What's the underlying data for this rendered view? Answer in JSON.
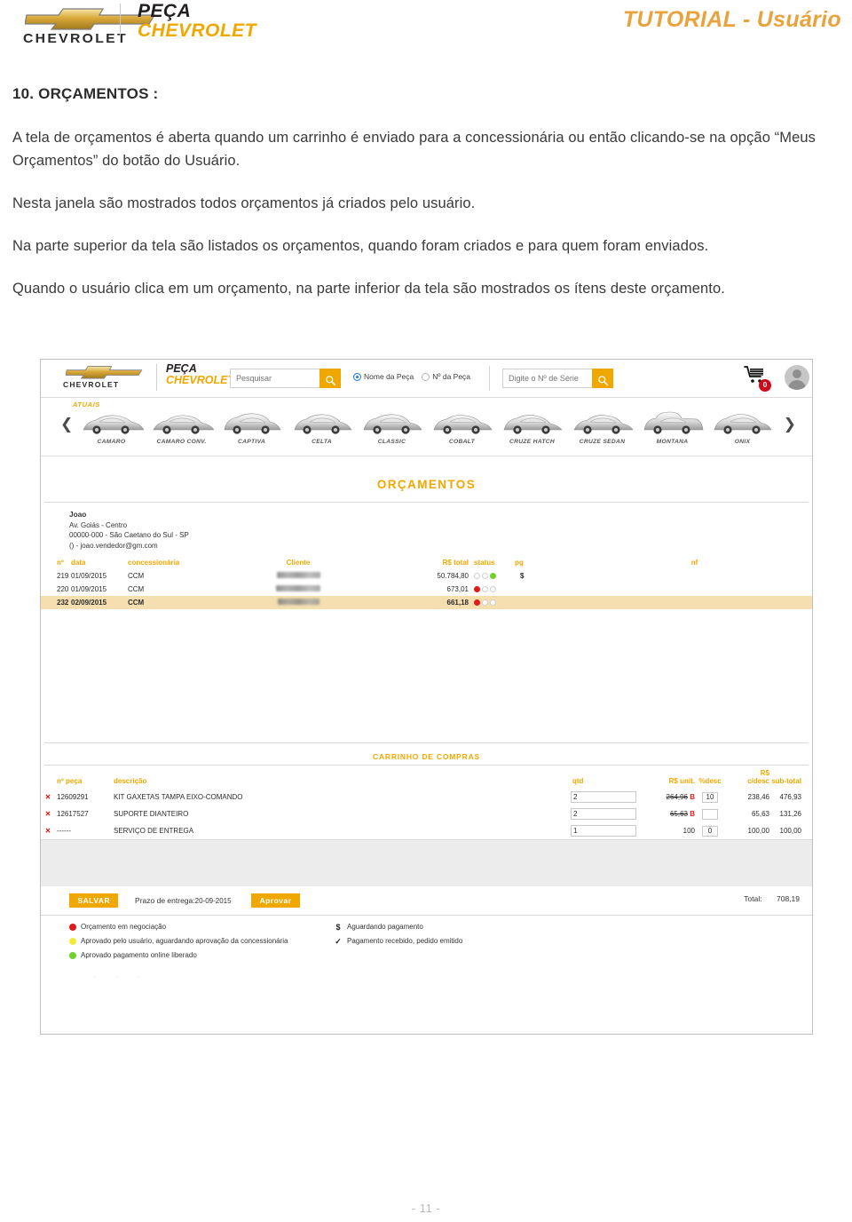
{
  "page_header": {
    "brand_word": "CHEVROLET",
    "brand_line1": "PEÇA",
    "brand_line2": "CHEVROLET",
    "tutorial_title": "TUTORIAL - Usuário"
  },
  "document": {
    "heading": "10. ORÇAMENTOS :",
    "paragraphs": [
      "A tela de orçamentos é aberta quando um carrinho é enviado para a concessionária ou então clicando-se na opção “Meus Orçamentos” do botão do Usuário.",
      "Nesta janela são mostrados todos orçamentos já criados pelo usuário.",
      "Na parte superior da tela são listados os orçamentos, quando foram criados e para quem foram enviados.",
      "Quando o usuário clica em um orçamento, na parte inferior da tela são mostrados os ítens deste orçamento."
    ],
    "page_number": "- 11 -"
  },
  "app": {
    "topbar": {
      "brand_word": "CHEVROLET",
      "brand_line1": "PEÇA",
      "brand_line2": "CHEVROLET",
      "search_placeholder": "Pesquisar",
      "search_value": "",
      "radio_options": [
        {
          "label": "Nome da Peça",
          "selected": true
        },
        {
          "label": "Nº da Peça",
          "selected": false
        }
      ],
      "serial_placeholder": "Digite o Nº de Série",
      "serial_value": "",
      "cart_count": "0",
      "search_icon": "search-icon",
      "cart_icon": "shopping-cart-icon",
      "avatar_icon": "user-avatar-icon"
    },
    "carousel": {
      "label": "ATUAIS",
      "prev_icon": "chevron-left-icon",
      "next_icon": "chevron-right-icon",
      "cars": [
        "CAMARO",
        "CAMARO CONV.",
        "CAPTIVA",
        "CELTA",
        "CLASSIC",
        "COBALT",
        "CRUZE HATCH",
        "CRUZE SEDAN",
        "MONTANA",
        "ONIX"
      ]
    },
    "orcamentos": {
      "title": "ORÇAMENTOS",
      "user": {
        "name": "Joao",
        "address": "Av. Goiás - Centro",
        "city": "00000-000 - São Caetano do Sul - SP",
        "contact": "() - joao.vendedor@gm.com"
      },
      "columns": [
        "nº",
        "data",
        "concessionária",
        "Cliente",
        "R$ total",
        "status",
        "pg",
        "nf"
      ],
      "rows": [
        {
          "num": "219",
          "data": "01/09/2015",
          "concessionaria": "CCM",
          "cliente": "",
          "total": "50.784,80",
          "status": [
            "off",
            "off",
            "green"
          ],
          "pg": "$",
          "nf": "",
          "selected": false
        },
        {
          "num": "220",
          "data": "01/09/2015",
          "concessionaria": "CCM",
          "cliente": "",
          "total": "673,01",
          "status": [
            "red",
            "off",
            "off"
          ],
          "pg": "",
          "nf": "",
          "selected": false
        },
        {
          "num": "232",
          "data": "02/09/2015",
          "concessionaria": "CCM",
          "cliente": "",
          "total": "661,18",
          "status": [
            "red",
            "off",
            "off"
          ],
          "pg": "",
          "nf": "",
          "selected": true
        }
      ]
    },
    "carrinho": {
      "title": "CARRINHO DE COMPRAS",
      "columns": [
        "nº peça",
        "descrição",
        "qtd",
        "R$ unit.",
        "%desc",
        "R$ c/desc",
        "sub-total"
      ],
      "col_rs_cdesc_line1": "R$",
      "col_rs_cdesc_line2": "c/desc",
      "remove_icon": "remove-x-icon",
      "items": [
        {
          "peca": "12609291",
          "descricao": "KIT GAXETAS TAMPA EIXO-COMANDO",
          "qtd": "2",
          "unit": "264,96",
          "unit_flag": "B",
          "desc": "10",
          "cdesc": "238,46",
          "subtotal": "476,93"
        },
        {
          "peca": "12617527",
          "descricao": "SUPORTE DIANTEIRO",
          "qtd": "2",
          "unit": "65,63",
          "unit_flag": "B",
          "desc": "",
          "cdesc": "65,63",
          "subtotal": "131,26"
        },
        {
          "peca": "------",
          "descricao": "SERVIÇO DE ENTREGA",
          "qtd": "1",
          "unit": "100",
          "unit_flag": "",
          "desc": "0",
          "cdesc": "100,00",
          "subtotal": "100,00"
        }
      ],
      "actions": {
        "save_label": "SALVAR",
        "prazo_label": "Prazo de entrega:",
        "prazo_value": "20-09-2015",
        "approve_label": "Aprovar",
        "total_label": "Total:",
        "total_value": "708,19"
      },
      "legend_left": [
        {
          "type": "dot",
          "color": "red",
          "text": "Orçamento em negociação"
        },
        {
          "type": "dot",
          "color": "yellow",
          "text": "Aprovado pelo usuário, aguardando aprovação da concessionária"
        },
        {
          "type": "dot",
          "color": "green",
          "text": "Aprovado pagamento online liberado"
        }
      ],
      "legend_right": [
        {
          "type": "symbol",
          "symbol": "$",
          "text": "Aguardando pagamento"
        },
        {
          "type": "symbol",
          "symbol": "✓",
          "text": "Pagamento recebido, pedido emitido"
        }
      ]
    }
  },
  "colors": {
    "brand_gold": "#f0a800",
    "tutorial_gold": "#e8a33d",
    "status_red": "#e01b1b",
    "status_green": "#6fd12a",
    "status_yellow": "#f3eb3a",
    "row_selected": "#f5dfb0"
  }
}
